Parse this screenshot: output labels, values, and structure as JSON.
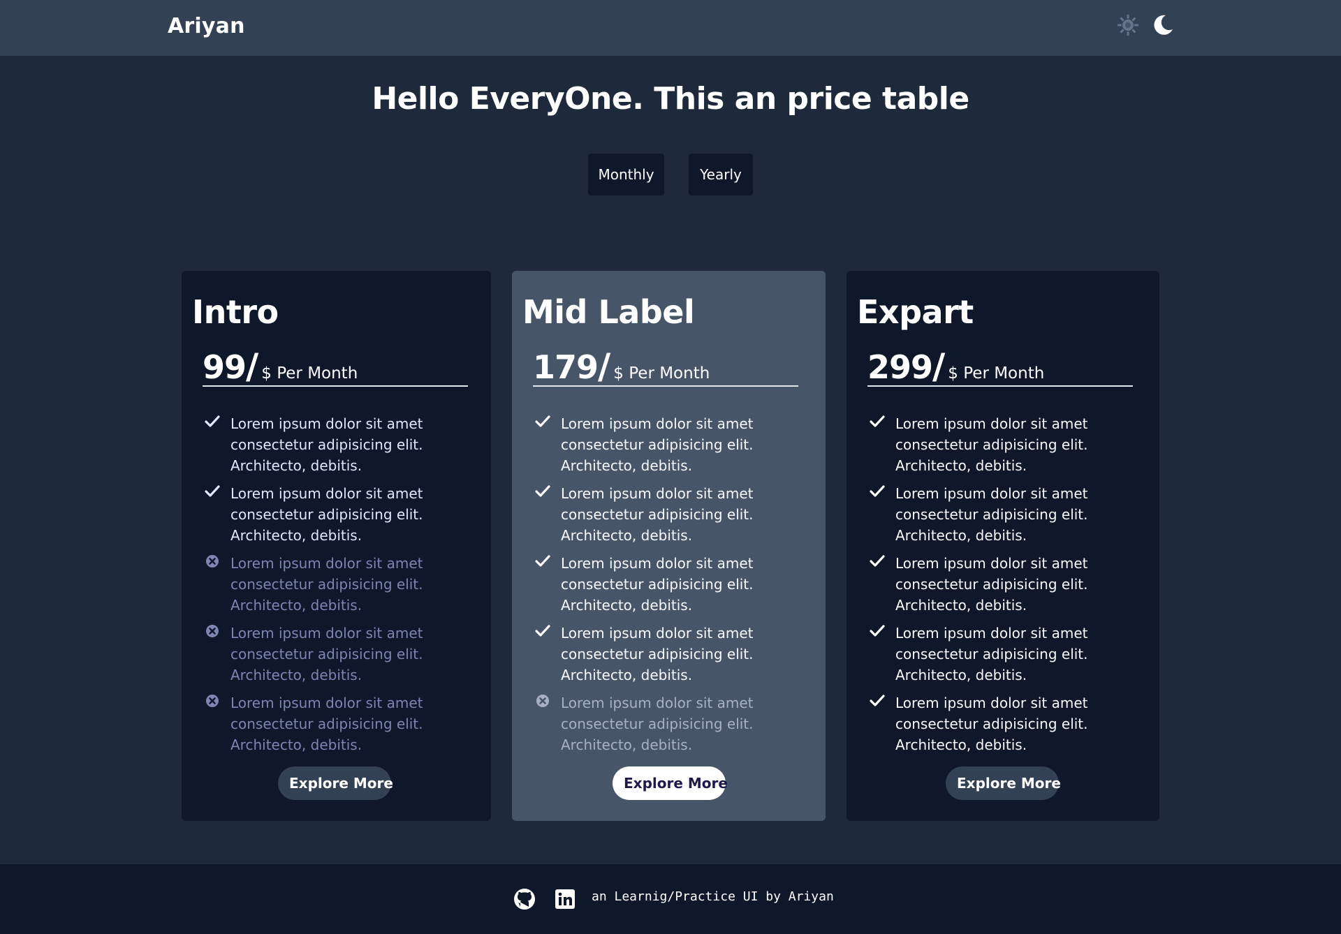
{
  "nav": {
    "brand": "Ariyan",
    "light_toggle_icon": "sun-icon",
    "dark_toggle_icon": "moon-icon"
  },
  "hero": {
    "title": "Hello EveryOne. This an price table"
  },
  "billing_toggle": {
    "monthly_label": "Monthly",
    "yearly_label": "Yearly"
  },
  "cards": [
    {
      "name": "Intro",
      "price": "99",
      "slash": "/",
      "period": "$ Per Month",
      "button_label": "Explore More",
      "features": [
        {
          "text": "Lorem ipsum dolor sit amet consectetur adipisicing elit. Architecto, debitis.",
          "included": true
        },
        {
          "text": "Lorem ipsum dolor sit amet consectetur adipisicing elit. Architecto, debitis.",
          "included": true
        },
        {
          "text": "Lorem ipsum dolor sit amet consectetur adipisicing elit. Architecto, debitis.",
          "included": false
        },
        {
          "text": "Lorem ipsum dolor sit amet consectetur adipisicing elit. Architecto, debitis.",
          "included": false
        },
        {
          "text": "Lorem ipsum dolor sit amet consectetur adipisicing elit. Architecto, debitis.",
          "included": false
        }
      ]
    },
    {
      "name": "Mid Label",
      "price": "179",
      "slash": "/",
      "period": "$ Per Month",
      "button_label": "Explore More",
      "features": [
        {
          "text": "Lorem ipsum dolor sit amet consectetur adipisicing elit. Architecto, debitis.",
          "included": true
        },
        {
          "text": "Lorem ipsum dolor sit amet consectetur adipisicing elit. Architecto, debitis.",
          "included": true
        },
        {
          "text": "Lorem ipsum dolor sit amet consectetur adipisicing elit. Architecto, debitis.",
          "included": true
        },
        {
          "text": "Lorem ipsum dolor sit amet consectetur adipisicing elit. Architecto, debitis.",
          "included": true
        },
        {
          "text": "Lorem ipsum dolor sit amet consectetur adipisicing elit. Architecto, debitis.",
          "included": false
        }
      ]
    },
    {
      "name": "Expart",
      "price": "299",
      "slash": "/",
      "period": "$ Per Month",
      "button_label": "Explore More",
      "features": [
        {
          "text": "Lorem ipsum dolor sit amet consectetur adipisicing elit. Architecto, debitis.",
          "included": true
        },
        {
          "text": "Lorem ipsum dolor sit amet consectetur adipisicing elit. Architecto, debitis.",
          "included": true
        },
        {
          "text": "Lorem ipsum dolor sit amet consectetur adipisicing elit. Architecto, debitis.",
          "included": true
        },
        {
          "text": "Lorem ipsum dolor sit amet consectetur adipisicing elit. Architecto, debitis.",
          "included": true
        },
        {
          "text": "Lorem ipsum dolor sit amet consectetur adipisicing elit. Architecto, debitis.",
          "included": true
        }
      ]
    }
  ],
  "footer": {
    "github_icon": "github-icon",
    "linkedin_icon": "linkedin-icon",
    "text": "an Learnig/Practice UI by Ariyan"
  },
  "colors": {
    "page_bg": "#1e293b",
    "navbar_bg": "#334155",
    "card_bg": "#0f172a",
    "featured_card_bg": "#475569",
    "footer_bg": "#0f172a"
  }
}
